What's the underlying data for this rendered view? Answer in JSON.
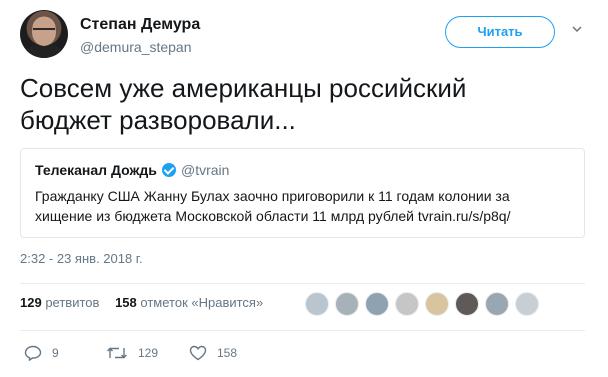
{
  "author": {
    "name": "Степан Демура",
    "handle": "@demura_stepan"
  },
  "follow_label": "Читать",
  "tweet": {
    "text_line1": "Совсем уже американцы российский",
    "text_line2": "бюджет разворовали..."
  },
  "quote": {
    "name": "Телеканал Дождь",
    "handle": "@tvrain",
    "text_line1": "Гражданку США Жанну Булах заочно приговорили к 11 годам колонии за",
    "text_line2": "хищение из бюджета Московской области 11 млрд рублей tvrain.ru/s/p8q/"
  },
  "timestamp": "2:32 - 23 янв. 2018 г.",
  "stats": {
    "retweets_count": "129",
    "retweets_label": "ретвитов",
    "likes_count": "158",
    "likes_label": "отметок «Нравится»"
  },
  "liker_avatars": [
    "#b9c6cf",
    "#a7b1b8",
    "#8fa2b1",
    "#c6c6c6",
    "#d8c5a0",
    "#5f5a58",
    "#9aa7b0",
    "#c7cfd5"
  ],
  "actions": {
    "replies": "9",
    "retweets": "129",
    "likes": "158"
  },
  "colors": {
    "accent": "#1da1f2",
    "muted": "#657786"
  }
}
